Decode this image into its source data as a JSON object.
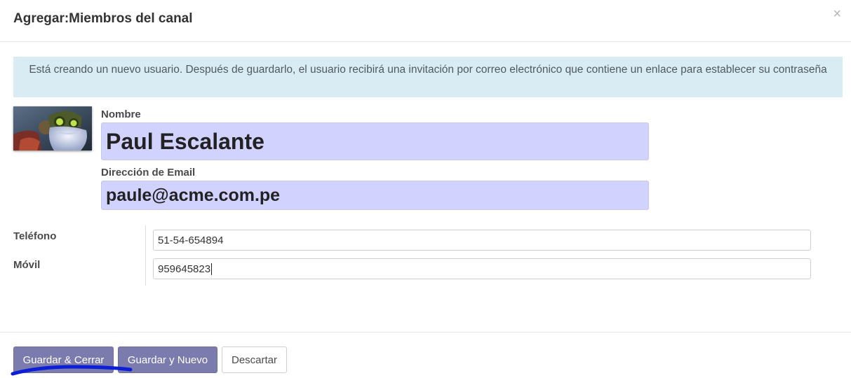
{
  "dialog": {
    "title": "Agregar:Miembros del canal",
    "close_symbol": "×"
  },
  "alert": {
    "text": "Está creando un nuevo usuario. Después de guardarlo, el usuario recibirá una invitación por correo electrónico que contiene un enlace para establecer su contraseña"
  },
  "form": {
    "avatar_icon": "user-avatar-image",
    "name_label": "Nombre",
    "name_value": "Paul Escalante",
    "email_label": "Dirección de Email",
    "email_value": "paule@acme.com.pe",
    "phone_label": "Teléfono",
    "phone_value": "51-54-654894",
    "mobile_label": "Móvil",
    "mobile_value": "959645823"
  },
  "footer": {
    "save_close_label": "Guardar & Cerrar",
    "save_new_label": "Guardar y Nuevo",
    "discard_label": "Descartar"
  },
  "colors": {
    "primary_button": "#7c7bad",
    "required_field_bg": "#d2d2ff",
    "alert_bg": "#d9ecf4",
    "annotation_stroke": "#0a1fd6"
  }
}
